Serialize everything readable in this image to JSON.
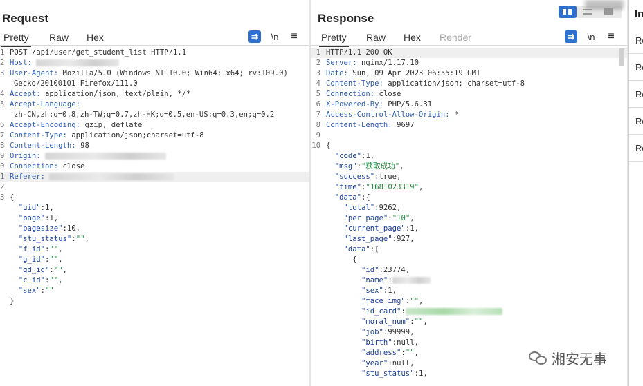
{
  "request": {
    "title": "Request",
    "tabs": [
      "Pretty",
      "Raw",
      "Hex"
    ],
    "active_tab": "Pretty",
    "tools": {
      "wrap_icon": "word-wrap-icon",
      "newline_label": "\\n",
      "menu_icon": "hamburger-menu-icon"
    },
    "lines": [
      {
        "n": "1",
        "parts": [
          {
            "t": "POST /api/user/get_student_list HTTP/1.1"
          }
        ]
      },
      {
        "n": "2",
        "parts": [
          {
            "t": "Host: ",
            "c": "hname"
          },
          {
            "blur": 120
          }
        ]
      },
      {
        "n": "3",
        "parts": [
          {
            "t": "User-Agent: ",
            "c": "hname"
          },
          {
            "t": "Mozilla/5.0 (Windows NT 10.0; Win64; x64; rv:109.0)"
          }
        ]
      },
      {
        "n": "",
        "cont": true,
        "parts": [
          {
            "t": "Gecko/20100101 Firefox/111.0"
          }
        ]
      },
      {
        "n": "4",
        "parts": [
          {
            "t": "Accept: ",
            "c": "hname"
          },
          {
            "t": "application/json, text/plain, */*"
          }
        ]
      },
      {
        "n": "5",
        "parts": [
          {
            "t": "Accept-Language: ",
            "c": "hname"
          }
        ]
      },
      {
        "n": "",
        "cont": true,
        "parts": [
          {
            "t": "zh-CN,zh;q=0.8,zh-TW;q=0.7,zh-HK;q=0.5,en-US;q=0.3,en;q=0.2"
          }
        ]
      },
      {
        "n": "6",
        "parts": [
          {
            "t": "Accept-Encoding: ",
            "c": "hname"
          },
          {
            "t": "gzip, deflate"
          }
        ]
      },
      {
        "n": "7",
        "parts": [
          {
            "t": "Content-Type: ",
            "c": "hname"
          },
          {
            "t": "application/json;charset=utf-8"
          }
        ]
      },
      {
        "n": "8",
        "parts": [
          {
            "t": "Content-Length: ",
            "c": "hname"
          },
          {
            "t": "98"
          }
        ]
      },
      {
        "n": "9",
        "parts": [
          {
            "t": "Origin: ",
            "c": "hname"
          },
          {
            "blur": 175
          }
        ]
      },
      {
        "n": "0",
        "parts": [
          {
            "t": "Connection: ",
            "c": "hname"
          },
          {
            "t": "close"
          }
        ]
      },
      {
        "n": "1",
        "hl": true,
        "parts": [
          {
            "t": "Referer: ",
            "c": "hname"
          },
          {
            "blur": 180
          }
        ]
      },
      {
        "n": "2",
        "parts": []
      },
      {
        "n": "3",
        "parts": [
          {
            "t": "{"
          }
        ]
      },
      {
        "n": "",
        "parts": [
          {
            "t": "  "
          },
          {
            "t": "\"uid\"",
            "c": "jkey"
          },
          {
            "t": ":1,"
          }
        ]
      },
      {
        "n": "",
        "parts": [
          {
            "t": "  "
          },
          {
            "t": "\"page\"",
            "c": "jkey"
          },
          {
            "t": ":1,"
          }
        ]
      },
      {
        "n": "",
        "parts": [
          {
            "t": "  "
          },
          {
            "t": "\"pagesize\"",
            "c": "jkey"
          },
          {
            "t": ":10,"
          }
        ]
      },
      {
        "n": "",
        "parts": [
          {
            "t": "  "
          },
          {
            "t": "\"stu_status\"",
            "c": "jkey"
          },
          {
            "t": ":"
          },
          {
            "t": "\"\"",
            "c": "jstr"
          },
          {
            "t": ","
          }
        ]
      },
      {
        "n": "",
        "parts": [
          {
            "t": "  "
          },
          {
            "t": "\"f_id\"",
            "c": "jkey"
          },
          {
            "t": ":"
          },
          {
            "t": "\"\"",
            "c": "jstr"
          },
          {
            "t": ","
          }
        ]
      },
      {
        "n": "",
        "parts": [
          {
            "t": "  "
          },
          {
            "t": "\"g_id\"",
            "c": "jkey"
          },
          {
            "t": ":"
          },
          {
            "t": "\"\"",
            "c": "jstr"
          },
          {
            "t": ","
          }
        ]
      },
      {
        "n": "",
        "parts": [
          {
            "t": "  "
          },
          {
            "t": "\"gd_id\"",
            "c": "jkey"
          },
          {
            "t": ":"
          },
          {
            "t": "\"\"",
            "c": "jstr"
          },
          {
            "t": ","
          }
        ]
      },
      {
        "n": "",
        "parts": [
          {
            "t": "  "
          },
          {
            "t": "\"c_id\"",
            "c": "jkey"
          },
          {
            "t": ":"
          },
          {
            "t": "\"\"",
            "c": "jstr"
          },
          {
            "t": ","
          }
        ]
      },
      {
        "n": "",
        "parts": [
          {
            "t": "  "
          },
          {
            "t": "\"sex\"",
            "c": "jkey"
          },
          {
            "t": ":"
          },
          {
            "t": "\"\"",
            "c": "jstr"
          }
        ]
      },
      {
        "n": "",
        "parts": [
          {
            "t": "}"
          }
        ]
      }
    ]
  },
  "response": {
    "title": "Response",
    "tabs": [
      "Pretty",
      "Raw",
      "Hex",
      "Render"
    ],
    "active_tab": "Pretty",
    "disabled_tab": "Render",
    "tools": {
      "wrap_icon": "word-wrap-icon",
      "newline_label": "\\n",
      "menu_icon": "hamburger-menu-icon"
    },
    "lines": [
      {
        "n": "1",
        "hl": true,
        "parts": [
          {
            "t": "HTTP/1.1 200 OK"
          }
        ]
      },
      {
        "n": "2",
        "parts": [
          {
            "t": "Server: ",
            "c": "hname"
          },
          {
            "t": "nginx/1.17.10"
          }
        ]
      },
      {
        "n": "3",
        "parts": [
          {
            "t": "Date: ",
            "c": "hname"
          },
          {
            "t": "Sun, 09 Apr 2023 06:55:19 GMT"
          }
        ]
      },
      {
        "n": "4",
        "parts": [
          {
            "t": "Content-Type: ",
            "c": "hname"
          },
          {
            "t": "application/json; charset=utf-8"
          }
        ]
      },
      {
        "n": "5",
        "parts": [
          {
            "t": "Connection: ",
            "c": "hname"
          },
          {
            "t": "close"
          }
        ]
      },
      {
        "n": "6",
        "parts": [
          {
            "t": "X-Powered-By: ",
            "c": "hname"
          },
          {
            "t": "PHP/5.6.31"
          }
        ]
      },
      {
        "n": "7",
        "parts": [
          {
            "t": "Access-Control-Allow-Origin: ",
            "c": "hname"
          },
          {
            "t": "*"
          }
        ]
      },
      {
        "n": "8",
        "parts": [
          {
            "t": "Content-Length: ",
            "c": "hname"
          },
          {
            "t": "9697"
          }
        ]
      },
      {
        "n": "9",
        "parts": []
      },
      {
        "n": "10",
        "parts": [
          {
            "t": "{"
          }
        ]
      },
      {
        "n": "",
        "parts": [
          {
            "t": "  "
          },
          {
            "t": "\"code\"",
            "c": "jkey"
          },
          {
            "t": ":1,"
          }
        ]
      },
      {
        "n": "",
        "parts": [
          {
            "t": "  "
          },
          {
            "t": "\"msg\"",
            "c": "jkey"
          },
          {
            "t": ":"
          },
          {
            "t": "\"获取成功\"",
            "c": "jstr"
          },
          {
            "t": ","
          }
        ]
      },
      {
        "n": "",
        "parts": [
          {
            "t": "  "
          },
          {
            "t": "\"success\"",
            "c": "jkey"
          },
          {
            "t": ":true,"
          }
        ]
      },
      {
        "n": "",
        "parts": [
          {
            "t": "  "
          },
          {
            "t": "\"time\"",
            "c": "jkey"
          },
          {
            "t": ":"
          },
          {
            "t": "\"1681023319\"",
            "c": "jstr"
          },
          {
            "t": ","
          }
        ]
      },
      {
        "n": "",
        "parts": [
          {
            "t": "  "
          },
          {
            "t": "\"data\"",
            "c": "jkey"
          },
          {
            "t": ":{"
          }
        ]
      },
      {
        "n": "",
        "parts": [
          {
            "t": "    "
          },
          {
            "t": "\"total\"",
            "c": "jkey"
          },
          {
            "t": ":9262,"
          }
        ]
      },
      {
        "n": "",
        "parts": [
          {
            "t": "    "
          },
          {
            "t": "\"per_page\"",
            "c": "jkey"
          },
          {
            "t": ":"
          },
          {
            "t": "\"10\"",
            "c": "jstr"
          },
          {
            "t": ","
          }
        ]
      },
      {
        "n": "",
        "parts": [
          {
            "t": "    "
          },
          {
            "t": "\"current_page\"",
            "c": "jkey"
          },
          {
            "t": ":1,"
          }
        ]
      },
      {
        "n": "",
        "parts": [
          {
            "t": "    "
          },
          {
            "t": "\"last_page\"",
            "c": "jkey"
          },
          {
            "t": ":927,"
          }
        ]
      },
      {
        "n": "",
        "parts": [
          {
            "t": "    "
          },
          {
            "t": "\"data\"",
            "c": "jkey"
          },
          {
            "t": ":["
          }
        ]
      },
      {
        "n": "",
        "parts": [
          {
            "t": "      {"
          }
        ]
      },
      {
        "n": "",
        "parts": [
          {
            "t": "        "
          },
          {
            "t": "\"id\"",
            "c": "jkey"
          },
          {
            "t": ":23774,"
          }
        ]
      },
      {
        "n": "",
        "parts": [
          {
            "t": "        "
          },
          {
            "t": "\"name\"",
            "c": "jkey"
          },
          {
            "t": ":"
          },
          {
            "blur": 55
          }
        ]
      },
      {
        "n": "",
        "parts": [
          {
            "t": "        "
          },
          {
            "t": "\"sex\"",
            "c": "jkey"
          },
          {
            "t": ":1,"
          }
        ]
      },
      {
        "n": "",
        "parts": [
          {
            "t": "        "
          },
          {
            "t": "\"face_img\"",
            "c": "jkey"
          },
          {
            "t": ":"
          },
          {
            "t": "\"\"",
            "c": "jstr"
          },
          {
            "t": ","
          }
        ]
      },
      {
        "n": "",
        "parts": [
          {
            "t": "        "
          },
          {
            "t": "\"id_card\"",
            "c": "jkey"
          },
          {
            "t": ":"
          },
          {
            "blur": 140,
            "green": true
          }
        ]
      },
      {
        "n": "",
        "parts": [
          {
            "t": "        "
          },
          {
            "t": "\"moral_num\"",
            "c": "jkey"
          },
          {
            "t": ":"
          },
          {
            "t": "\"\"",
            "c": "jstr"
          },
          {
            "t": ","
          }
        ]
      },
      {
        "n": "",
        "parts": [
          {
            "t": "        "
          },
          {
            "t": "\"job\"",
            "c": "jkey"
          },
          {
            "t": ":99999,"
          }
        ]
      },
      {
        "n": "",
        "parts": [
          {
            "t": "        "
          },
          {
            "t": "\"birth\"",
            "c": "jkey"
          },
          {
            "t": ":null,"
          }
        ]
      },
      {
        "n": "",
        "parts": [
          {
            "t": "        "
          },
          {
            "t": "\"address\"",
            "c": "jkey"
          },
          {
            "t": ":"
          },
          {
            "t": "\"\"",
            "c": "jstr"
          },
          {
            "t": ","
          }
        ]
      },
      {
        "n": "",
        "parts": [
          {
            "t": "        "
          },
          {
            "t": "\"year\"",
            "c": "jkey"
          },
          {
            "t": ":null,"
          }
        ]
      },
      {
        "n": "",
        "parts": [
          {
            "t": "        "
          },
          {
            "t": "\"stu_status\"",
            "c": "jkey"
          },
          {
            "t": ":1,"
          }
        ]
      }
    ]
  },
  "side": {
    "title": "In",
    "items": [
      "Re",
      "Re",
      "Re",
      "Re",
      "Re"
    ]
  },
  "view_toggle": {
    "icon": "layout-toggle-icon"
  },
  "watermark": {
    "icon": "wechat-icon",
    "text": "湘安无事"
  },
  "colors": {
    "accent": "#2f6fd0",
    "header_name": "#2f5fb5",
    "json_key": "#1a3f9e",
    "json_string": "#1e8a3e"
  }
}
